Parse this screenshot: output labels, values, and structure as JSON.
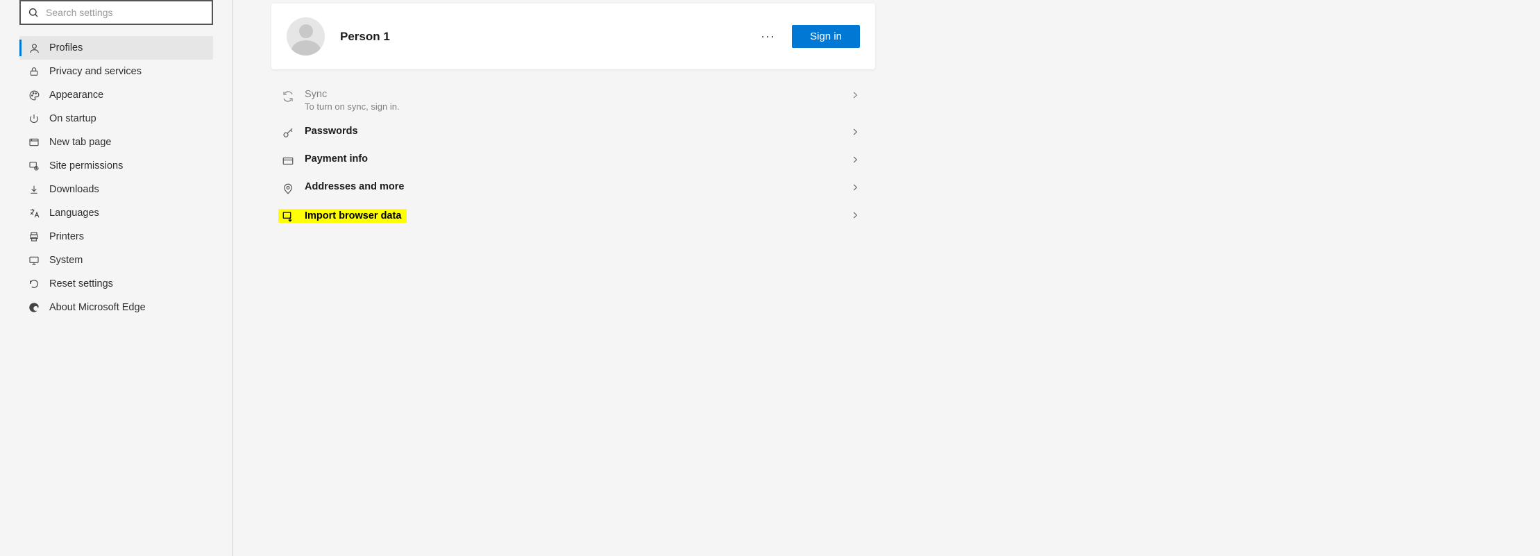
{
  "search": {
    "placeholder": "Search settings",
    "value": ""
  },
  "sidebar": {
    "items": [
      {
        "label": "Profiles"
      },
      {
        "label": "Privacy and services"
      },
      {
        "label": "Appearance"
      },
      {
        "label": "On startup"
      },
      {
        "label": "New tab page"
      },
      {
        "label": "Site permissions"
      },
      {
        "label": "Downloads"
      },
      {
        "label": "Languages"
      },
      {
        "label": "Printers"
      },
      {
        "label": "System"
      },
      {
        "label": "Reset settings"
      },
      {
        "label": "About Microsoft Edge"
      }
    ]
  },
  "profile": {
    "name": "Person 1",
    "signin_label": "Sign in"
  },
  "rows": {
    "sync": {
      "title": "Sync",
      "subtitle": "To turn on sync, sign in."
    },
    "passwords": {
      "title": "Passwords"
    },
    "payment": {
      "title": "Payment info"
    },
    "addresses": {
      "title": "Addresses and more"
    },
    "import": {
      "title": "Import browser data"
    }
  }
}
